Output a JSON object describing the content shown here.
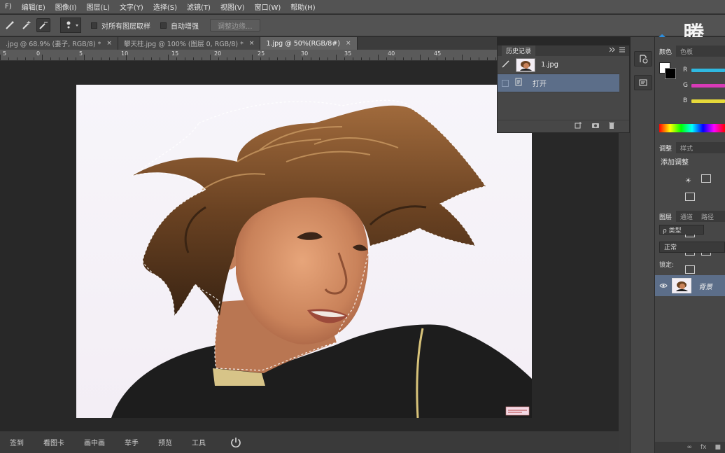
{
  "menu": {
    "items": [
      "F)",
      "编辑(E)",
      "图像(I)",
      "图层(L)",
      "文字(Y)",
      "选择(S)",
      "滤镜(T)",
      "视图(V)",
      "窗口(W)",
      "帮助(H)"
    ]
  },
  "options": {
    "sample_all_layers": "对所有图层取样",
    "auto_enhance": "自动增强",
    "refine_edge": "调整边缘..."
  },
  "watermark": {
    "text": "腾讯"
  },
  "tabs": [
    {
      "label": ".jpg @ 68.9% (妻子, RGB/8) *",
      "close": "×"
    },
    {
      "label": "攀天柱.jpg @ 100% (图层 0, RGB/8) *",
      "close": "×"
    },
    {
      "label": "1.jpg @ 50%(RGB/8#)",
      "close": "×"
    }
  ],
  "ruler": {
    "labels": [
      "5",
      "0",
      "5",
      "10",
      "15",
      "20",
      "25",
      "30",
      "35",
      "40",
      "45"
    ]
  },
  "history": {
    "title": "历史记录",
    "snapshot_label": "1.jpg",
    "steps": [
      "打开"
    ]
  },
  "bottom_bar": {
    "items": [
      "签到",
      "看图卡",
      "画中画",
      "举手",
      "预览",
      "工具"
    ]
  },
  "right": {
    "color_tabs": [
      "颜色",
      "色板"
    ],
    "sliders": [
      {
        "letter": "R",
        "color": "#2fb8e0"
      },
      {
        "letter": "G",
        "color": "#d83ab6"
      },
      {
        "letter": "B",
        "color": "#e6d93a"
      }
    ],
    "adjust_tabs": [
      "调整",
      "样式"
    ],
    "add_adjustment": "添加调整",
    "layers_tabs": [
      "图层",
      "通道",
      "路径"
    ],
    "kind_filter": "ρ 类型",
    "blend_mode": "正常",
    "lock_label": "锁定:",
    "layer_name": "背景"
  },
  "colors": {
    "selection": "#5c6e89",
    "panel": "#474747",
    "menubar": "#535353"
  }
}
